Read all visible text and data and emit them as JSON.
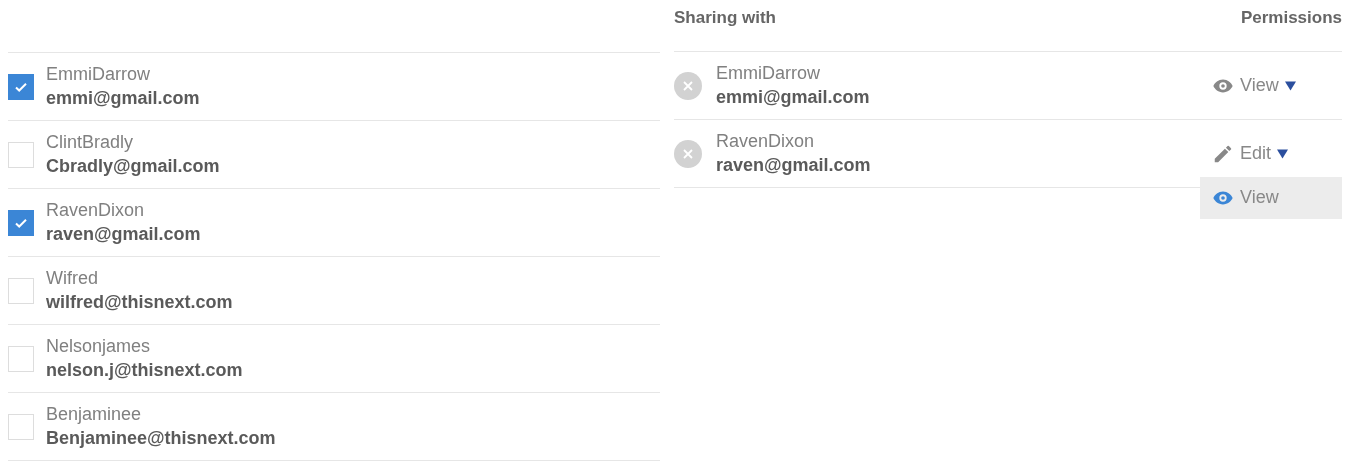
{
  "contacts": [
    {
      "name": "EmmiDarrow",
      "email": "emmi@gmail.com",
      "checked": true
    },
    {
      "name": "ClintBradly",
      "email": "Cbradly@gmail.com",
      "checked": false
    },
    {
      "name": "RavenDixon",
      "email": "raven@gmail.com",
      "checked": true
    },
    {
      "name": "Wifred",
      "email": "wilfred@thisnext.com",
      "checked": false
    },
    {
      "name": "Nelsonjames",
      "email": "nelson.j@thisnext.com",
      "checked": false
    },
    {
      "name": "Benjaminee",
      "email": "Benjaminee@thisnext.com",
      "checked": false
    }
  ],
  "sharing": {
    "title": "Sharing with",
    "permissions_title": "Permissions",
    "people": [
      {
        "name": "EmmiDarrow",
        "email": "emmi@gmail.com",
        "permission": {
          "kind": "view",
          "label": "View"
        }
      },
      {
        "name": "RavenDixon",
        "email": "raven@gmail.com",
        "permission": {
          "kind": "edit",
          "label": "Edit"
        },
        "menu": [
          {
            "kind": "view",
            "label": "View"
          }
        ]
      }
    ]
  }
}
